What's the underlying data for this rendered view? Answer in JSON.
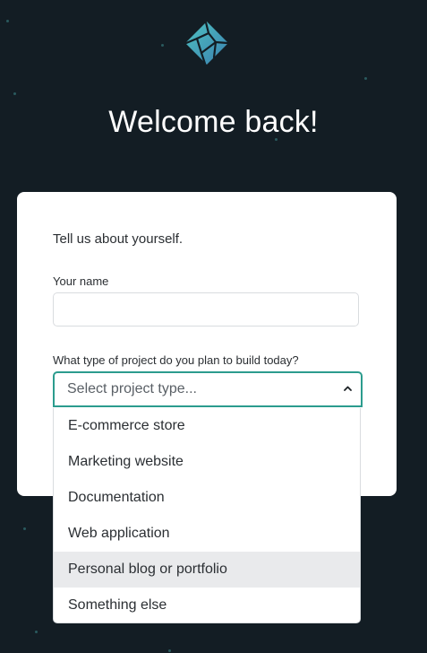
{
  "page": {
    "title": "Welcome back!"
  },
  "logo": {
    "icon": "netlify-logo-icon",
    "color": "#4fa9b0"
  },
  "form": {
    "intro": "Tell us about yourself.",
    "name_label": "Your name",
    "name_value": "",
    "project_label": "What type of project do you plan to build today?",
    "select_placeholder": "Select project type...",
    "caret_icon": "chevron-up-icon",
    "accent_color": "#2c9c8e"
  },
  "dropdown": {
    "options": [
      {
        "label": "E-commerce store"
      },
      {
        "label": "Marketing website"
      },
      {
        "label": "Documentation"
      },
      {
        "label": "Web application"
      },
      {
        "label": "Personal blog or portfolio",
        "highlighted": true
      },
      {
        "label": "Something else"
      }
    ]
  }
}
